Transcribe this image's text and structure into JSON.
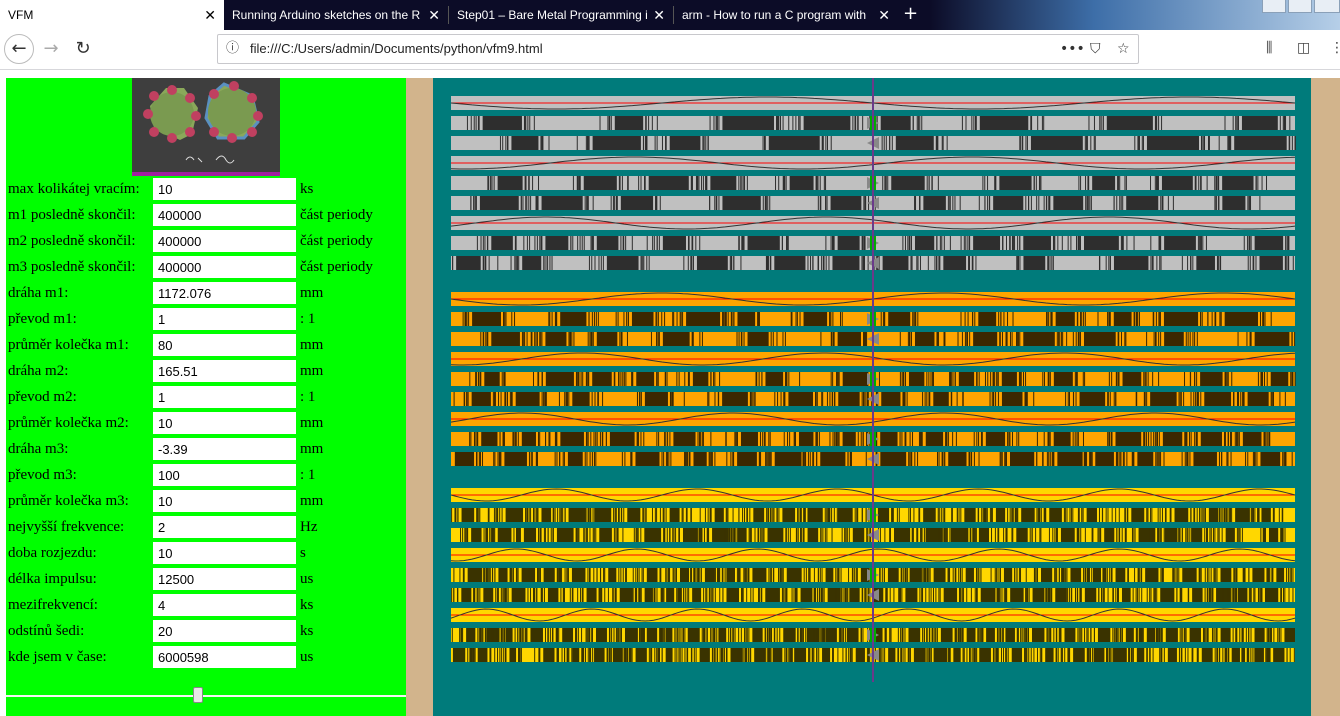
{
  "browser": {
    "tabs": [
      {
        "label": "VFM",
        "active": true
      },
      {
        "label": "Running Arduino sketches on the R",
        "active": false
      },
      {
        "label": "Step01 – Bare Metal Programming i",
        "active": false
      },
      {
        "label": "arm - How to run a C program with",
        "active": false
      }
    ],
    "new_tab_symbol": "+",
    "url": "file:///C:/Users/admin/Documents/python/vfm9.html"
  },
  "form": {
    "rows": [
      {
        "label": "max kolikátej vracím:",
        "value": "10",
        "unit": "ks"
      },
      {
        "label": "m1 posledně skončil:",
        "value": "400000",
        "unit": "část periody"
      },
      {
        "label": "m2 posledně skončil:",
        "value": "400000",
        "unit": "část periody"
      },
      {
        "label": "m3 posledně skončil:",
        "value": "400000",
        "unit": "část periody"
      },
      {
        "label": "dráha m1:",
        "value": "1172.076",
        "unit": "mm"
      },
      {
        "label": "převod m1:",
        "value": "1",
        "unit": ": 1"
      },
      {
        "label": "průměr kolečka m1:",
        "value": "80",
        "unit": "mm"
      },
      {
        "label": "dráha m2:",
        "value": "165.51",
        "unit": "mm"
      },
      {
        "label": "převod m2:",
        "value": "1",
        "unit": ": 1"
      },
      {
        "label": "průměr kolečka m2:",
        "value": "10",
        "unit": "mm"
      },
      {
        "label": "dráha m3:",
        "value": "-3.39",
        "unit": "mm"
      },
      {
        "label": "převod m3:",
        "value": "100",
        "unit": ": 1"
      },
      {
        "label": "průměr kolečka m3:",
        "value": "10",
        "unit": "mm"
      },
      {
        "label": "nejvyšší frekvence:",
        "value": "2",
        "unit": "Hz"
      },
      {
        "label": "doba rozjezdu:",
        "value": "10",
        "unit": "s"
      },
      {
        "label": "délka impulsu:",
        "value": "12500",
        "unit": "us"
      },
      {
        "label": "mezifrekvencí:",
        "value": "4",
        "unit": "ks"
      },
      {
        "label": "odstínů šedi:",
        "value": "20",
        "unit": "ks"
      },
      {
        "label": "kde jsem v čase:",
        "value": "6000598",
        "unit": "us"
      }
    ],
    "time_slider_fraction": 0.48
  },
  "colors": {
    "panel": "#00ff00",
    "viz_bg": "#007b7b",
    "tan": "#d2b48c",
    "group1_light": "#c0c0c0",
    "group1_dark": "#2e2e2e",
    "group2_light": "#ffa500",
    "group2_dark": "#3c2800",
    "group3_light": "#ffd700",
    "group3_dark": "#3a3300",
    "marker": "#888888",
    "cursor": "#6a3a8a",
    "sine_center": "#ff0000"
  },
  "viz": {
    "groups": [
      {
        "light": "#c0c0c0",
        "dark": "#2e2e2e",
        "freqs": [
          2.0,
          2.5,
          3.0
        ]
      },
      {
        "light": "#ffa500",
        "dark": "#3c2800",
        "freqs": [
          3.0,
          3.5,
          4.0
        ]
      },
      {
        "light": "#ffd700",
        "dark": "#3a3300",
        "freqs": [
          6.0,
          7.0,
          8.0
        ]
      }
    ]
  }
}
